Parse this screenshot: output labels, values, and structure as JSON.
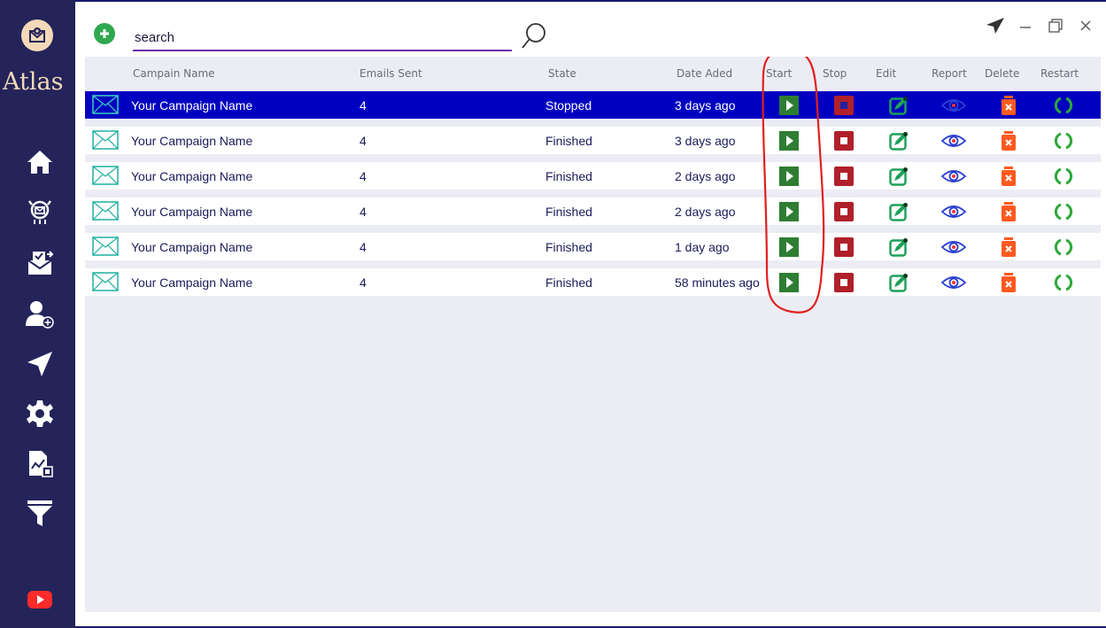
{
  "app": {
    "name": "Atlas"
  },
  "search": {
    "placeholder": "search",
    "value": ""
  },
  "columns": {
    "campaign_name": "Campain Name",
    "emails_sent": "Emails Sent",
    "state": "State",
    "date": "Date Aded",
    "start": "Start",
    "stop": "Stop",
    "edit": "Edit",
    "report": "Report",
    "delete": "Delete",
    "restart": "Restart"
  },
  "rows": [
    {
      "name": "Your Campaign Name",
      "emails_sent": "4",
      "state": "Stopped",
      "date": "3 days ago",
      "selected": true
    },
    {
      "name": "Your Campaign Name",
      "emails_sent": "4",
      "state": "Finished",
      "date": "3 days ago",
      "selected": false
    },
    {
      "name": "Your Campaign Name",
      "emails_sent": "4",
      "state": "Finished",
      "date": "2 days ago",
      "selected": false
    },
    {
      "name": "Your Campaign Name",
      "emails_sent": "4",
      "state": "Finished",
      "date": "2 days ago",
      "selected": false
    },
    {
      "name": "Your Campaign Name",
      "emails_sent": "4",
      "state": "Finished",
      "date": "1 day ago",
      "selected": false
    },
    {
      "name": "Your Campaign Name",
      "emails_sent": "4",
      "state": "Finished",
      "date": "58 minutes ago",
      "selected": false
    }
  ],
  "sidebar": {
    "icons": [
      "home-icon",
      "robot-icon",
      "campaign-mail-icon",
      "add-user-icon",
      "send-icon",
      "gear-icon",
      "report-file-icon",
      "filter-icon",
      "youtube-icon"
    ]
  },
  "colors": {
    "sidebar_bg": "#24245a",
    "selected_row": "#0000c0",
    "start_green": "#2e7d32",
    "stop_red": "#b0202a",
    "edit_green": "#1fa05a",
    "report_blue": "#2a3fd0",
    "delete_orange": "#ff5a1f",
    "restart_green": "#2ea83a",
    "annotation_red": "#e02020"
  }
}
